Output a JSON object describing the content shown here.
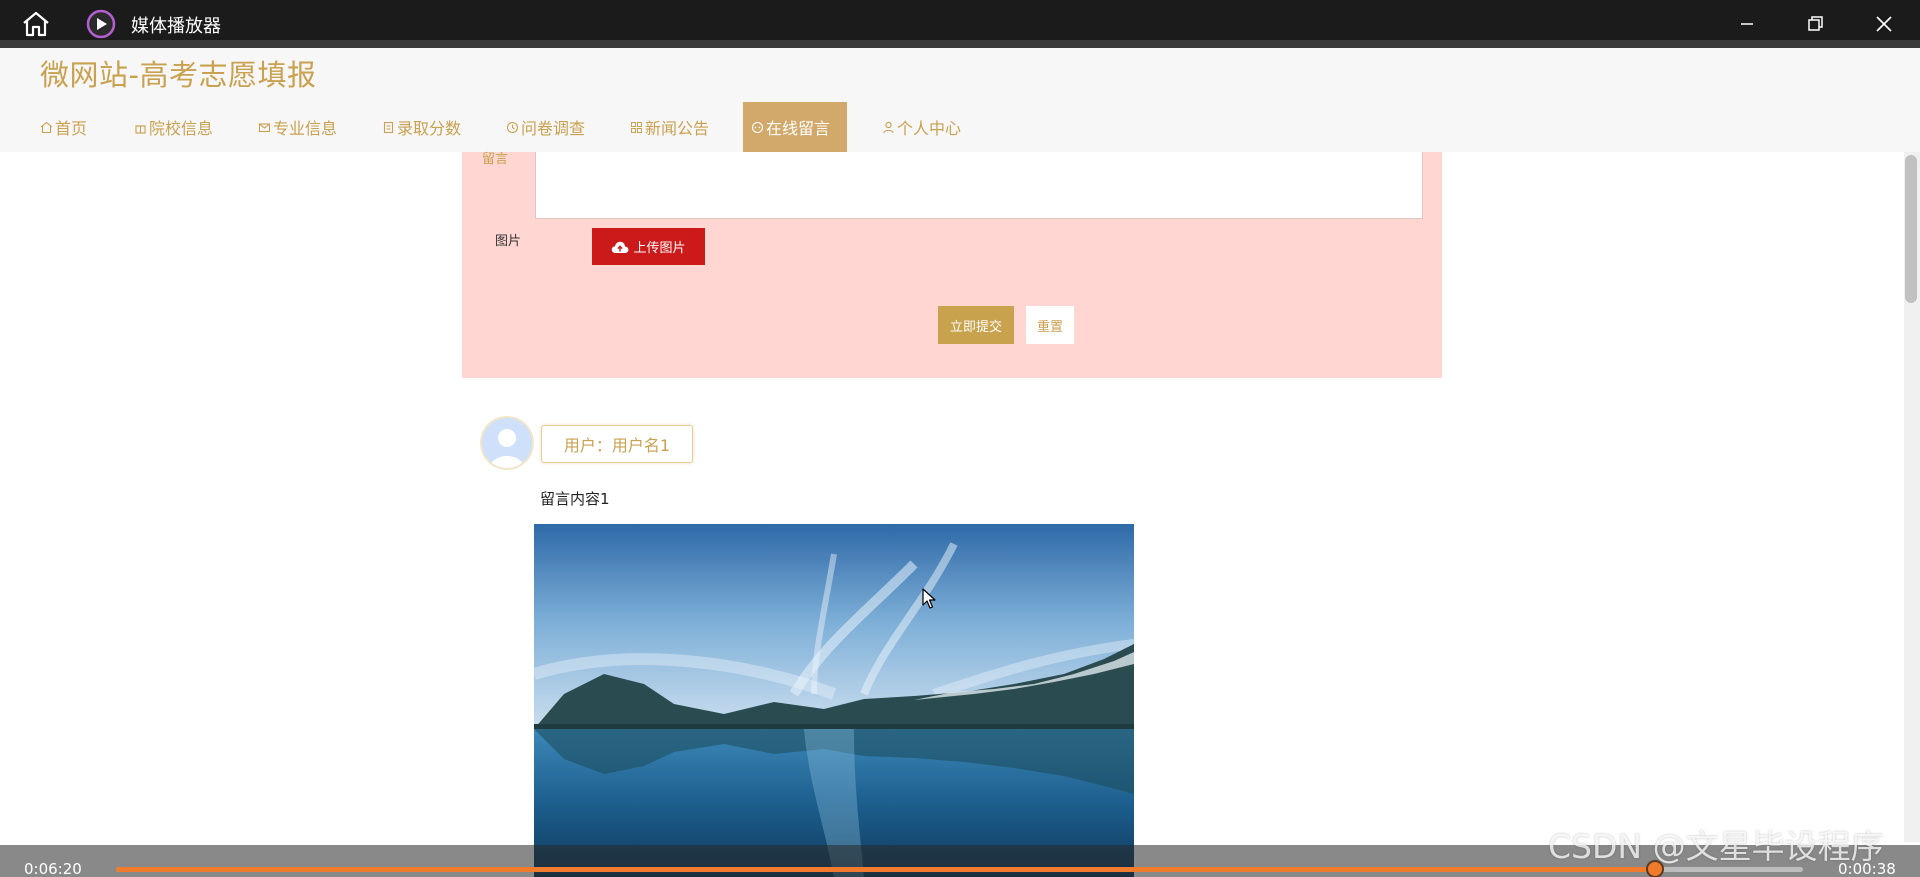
{
  "window": {
    "app_title": "媒体播放器"
  },
  "site": {
    "title": "微网站-高考志愿填报",
    "nav": [
      {
        "label": "首页",
        "icon": "home-icon"
      },
      {
        "label": "院校信息",
        "icon": "gift-icon"
      },
      {
        "label": "专业信息",
        "icon": "mail-icon"
      },
      {
        "label": "录取分数",
        "icon": "document-icon"
      },
      {
        "label": "问卷调查",
        "icon": "clock-icon"
      },
      {
        "label": "新闻公告",
        "icon": "news-icon"
      },
      {
        "label": "在线留言",
        "icon": "chat-icon",
        "active": true
      },
      {
        "label": "个人中心",
        "icon": "user-icon"
      }
    ]
  },
  "form": {
    "message_label": "留言",
    "image_label": "图片",
    "upload_label": "上传图片",
    "submit_label": "立即提交",
    "reset_label": "重置"
  },
  "comment": {
    "username": "用户：用户名1",
    "content": "留言内容1"
  },
  "player": {
    "current_time": "0:06:20",
    "remaining_time": "0:00:38",
    "progress_percent": 91.2
  },
  "watermark": "CSDN @文星毕设程序",
  "colors": {
    "accent": "#c9a14f",
    "active_nav": "#d2a96b",
    "form_bg": "#ffd6d2",
    "upload_button": "#cc1a1a",
    "submit_button": "#c8a24d",
    "progress": "#f07b2c"
  }
}
